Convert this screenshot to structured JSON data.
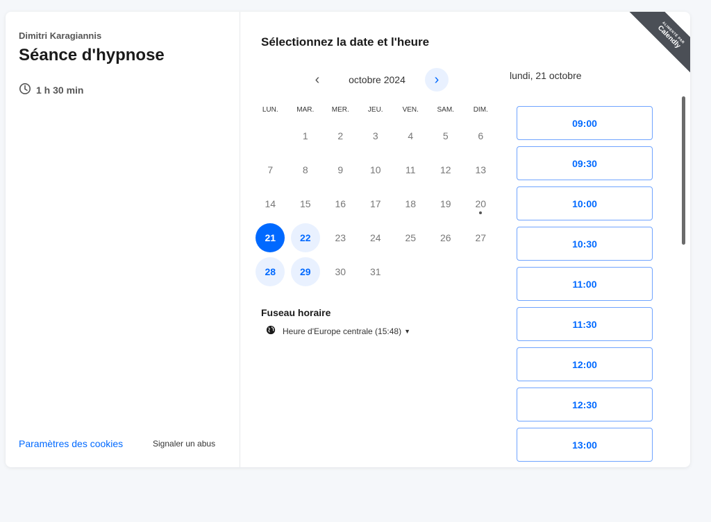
{
  "host_name": "Dimitri Karagiannis",
  "event_title": "Séance d'hypnose",
  "duration": "1 h 30 min",
  "footer": {
    "cookie_settings": "Paramètres des cookies",
    "report_abuse": "Signaler un abus"
  },
  "section_title": "Sélectionnez la date et l'heure",
  "month_label": "octobre 2024",
  "weekdays": [
    "LUN.",
    "MAR.",
    "MER.",
    "JEU.",
    "VEN.",
    "SAM.",
    "DIM."
  ],
  "days": [
    {
      "n": "",
      "state": "empty"
    },
    {
      "n": "1",
      "state": "disabled"
    },
    {
      "n": "2",
      "state": "disabled"
    },
    {
      "n": "3",
      "state": "disabled"
    },
    {
      "n": "4",
      "state": "disabled"
    },
    {
      "n": "5",
      "state": "disabled"
    },
    {
      "n": "6",
      "state": "disabled"
    },
    {
      "n": "7",
      "state": "disabled"
    },
    {
      "n": "8",
      "state": "disabled"
    },
    {
      "n": "9",
      "state": "disabled"
    },
    {
      "n": "10",
      "state": "disabled"
    },
    {
      "n": "11",
      "state": "disabled"
    },
    {
      "n": "12",
      "state": "disabled"
    },
    {
      "n": "13",
      "state": "disabled"
    },
    {
      "n": "14",
      "state": "disabled"
    },
    {
      "n": "15",
      "state": "disabled"
    },
    {
      "n": "16",
      "state": "disabled"
    },
    {
      "n": "17",
      "state": "disabled"
    },
    {
      "n": "18",
      "state": "disabled"
    },
    {
      "n": "19",
      "state": "disabled"
    },
    {
      "n": "20",
      "state": "today"
    },
    {
      "n": "21",
      "state": "selected"
    },
    {
      "n": "22",
      "state": "available"
    },
    {
      "n": "23",
      "state": "disabled"
    },
    {
      "n": "24",
      "state": "disabled"
    },
    {
      "n": "25",
      "state": "disabled"
    },
    {
      "n": "26",
      "state": "disabled"
    },
    {
      "n": "27",
      "state": "disabled"
    },
    {
      "n": "28",
      "state": "available"
    },
    {
      "n": "29",
      "state": "available"
    },
    {
      "n": "30",
      "state": "disabled"
    },
    {
      "n": "31",
      "state": "disabled"
    }
  ],
  "timezone_label": "Fuseau horaire",
  "timezone_value": "Heure d'Europe centrale (15:48)",
  "selected_date": "lundi, 21 octobre",
  "time_slots": [
    "09:00",
    "09:30",
    "10:00",
    "10:30",
    "11:00",
    "11:30",
    "12:00",
    "12:30",
    "13:00"
  ],
  "badge": {
    "small": "ALIMENTÉ PAR",
    "big": "Calendly"
  },
  "colors": {
    "accent": "#0069ff",
    "accent_light": "#e9f1ff",
    "badge": "#4b4f56"
  },
  "icons": {
    "duration": "clock-icon",
    "timezone": "globe-icon",
    "prev": "chevron-left-icon",
    "next": "chevron-right-icon"
  }
}
